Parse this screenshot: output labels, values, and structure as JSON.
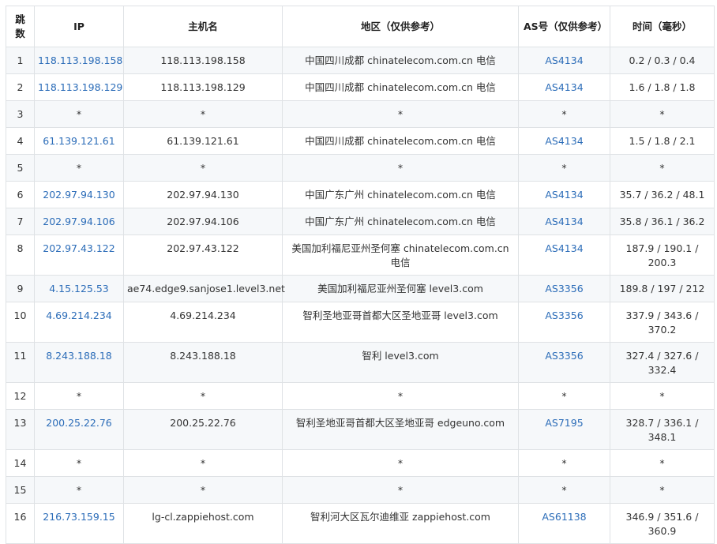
{
  "table": {
    "headers": [
      "跳数",
      "IP",
      "主机名",
      "地区（仅供参考）",
      "AS号（仅供参考）",
      "时间（毫秒）"
    ],
    "rows": [
      {
        "hop": "1",
        "ip": "118.113.198.158",
        "host": "118.113.198.158",
        "region": "中国四川成都 chinatelecom.com.cn 电信",
        "as": "AS4134",
        "time": "0.2 / 0.3 / 0.4"
      },
      {
        "hop": "2",
        "ip": "118.113.198.129",
        "host": "118.113.198.129",
        "region": "中国四川成都 chinatelecom.com.cn 电信",
        "as": "AS4134",
        "time": "1.6 / 1.8 / 1.8"
      },
      {
        "hop": "3",
        "ip": "*",
        "host": "*",
        "region": "*",
        "as": "*",
        "time": "*"
      },
      {
        "hop": "4",
        "ip": "61.139.121.61",
        "host": "61.139.121.61",
        "region": "中国四川成都 chinatelecom.com.cn 电信",
        "as": "AS4134",
        "time": "1.5 / 1.8 / 2.1"
      },
      {
        "hop": "5",
        "ip": "*",
        "host": "*",
        "region": "*",
        "as": "*",
        "time": "*"
      },
      {
        "hop": "6",
        "ip": "202.97.94.130",
        "host": "202.97.94.130",
        "region": "中国广东广州 chinatelecom.com.cn 电信",
        "as": "AS4134",
        "time": "35.7 / 36.2 / 48.1"
      },
      {
        "hop": "7",
        "ip": "202.97.94.106",
        "host": "202.97.94.106",
        "region": "中国广东广州 chinatelecom.com.cn 电信",
        "as": "AS4134",
        "time": "35.8 / 36.1 / 36.2"
      },
      {
        "hop": "8",
        "ip": "202.97.43.122",
        "host": "202.97.43.122",
        "region": "美国加利福尼亚州圣何塞 chinatelecom.com.cn 电信",
        "as": "AS4134",
        "time": "187.9 / 190.1 / 200.3"
      },
      {
        "hop": "9",
        "ip": "4.15.125.53",
        "host": "ae74.edge9.sanjose1.level3.net",
        "region": "美国加利福尼亚州圣何塞 level3.com",
        "as": "AS3356",
        "time": "189.8 / 197 / 212"
      },
      {
        "hop": "10",
        "ip": "4.69.214.234",
        "host": "4.69.214.234",
        "region": "智利圣地亚哥首都大区圣地亚哥 level3.com",
        "as": "AS3356",
        "time": "337.9 / 343.6 / 370.2"
      },
      {
        "hop": "11",
        "ip": "8.243.188.18",
        "host": "8.243.188.18",
        "region": "智利 level3.com",
        "as": "AS3356",
        "time": "327.4 / 327.6 / 332.4"
      },
      {
        "hop": "12",
        "ip": "*",
        "host": "*",
        "region": "*",
        "as": "*",
        "time": "*"
      },
      {
        "hop": "13",
        "ip": "200.25.22.76",
        "host": "200.25.22.76",
        "region": "智利圣地亚哥首都大区圣地亚哥 edgeuno.com",
        "as": "AS7195",
        "time": "328.7 / 336.1 / 348.1"
      },
      {
        "hop": "14",
        "ip": "*",
        "host": "*",
        "region": "*",
        "as": "*",
        "time": "*"
      },
      {
        "hop": "15",
        "ip": "*",
        "host": "*",
        "region": "*",
        "as": "*",
        "time": "*"
      },
      {
        "hop": "16",
        "ip": "216.73.159.15",
        "host": "lg-cl.zappiehost.com",
        "region": "智利河大区瓦尔迪维亚 zappiehost.com",
        "as": "AS61138",
        "time": "346.9 / 351.6 / 360.9"
      }
    ]
  },
  "colors": {
    "link": "#2b6cb8",
    "border": "#dfe2e5",
    "stripe": "#f6f8fa",
    "text": "#333333"
  }
}
